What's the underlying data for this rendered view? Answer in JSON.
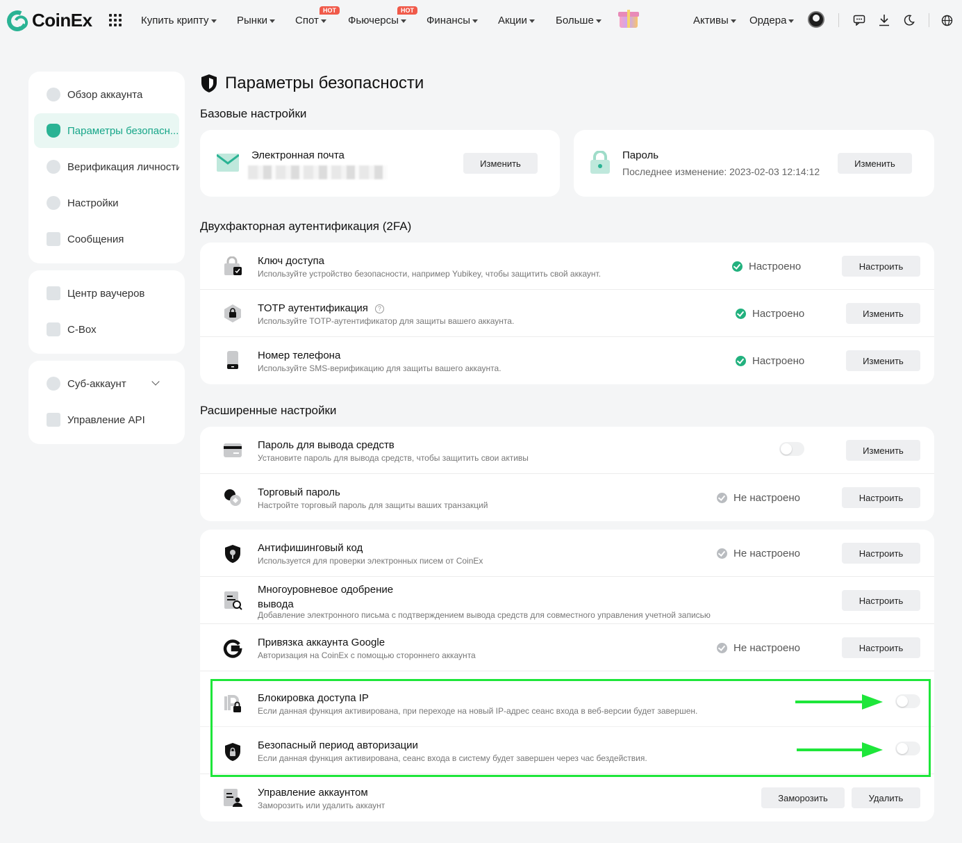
{
  "brand": {
    "name": "CoinEx",
    "accent": "#2ab394"
  },
  "nav": {
    "items": [
      {
        "label": "Купить крипту",
        "dropdown": true
      },
      {
        "label": "Рынки",
        "dropdown": true
      },
      {
        "label": "Спот",
        "dropdown": true,
        "badge": "HOT"
      },
      {
        "label": "Фьючерсы",
        "dropdown": true,
        "badge": "HOT"
      },
      {
        "label": "Финансы",
        "dropdown": true
      },
      {
        "label": "Акции",
        "dropdown": true
      },
      {
        "label": "Больше",
        "dropdown": true
      }
    ],
    "right": [
      {
        "label": "Активы",
        "dropdown": true
      },
      {
        "label": "Ордера",
        "dropdown": true
      }
    ],
    "icons": [
      "avatar",
      "chat-icon",
      "download-icon",
      "moon-icon",
      "globe-icon"
    ]
  },
  "sidebar": {
    "group1": [
      {
        "label": "Обзор аккаунта",
        "active": false
      },
      {
        "label": "Параметры безопасн...",
        "active": true
      },
      {
        "label": "Верификация личности",
        "active": false
      },
      {
        "label": "Настройки",
        "active": false
      },
      {
        "label": "Сообщения",
        "active": false
      }
    ],
    "group2": [
      {
        "label": "Центр ваучеров"
      },
      {
        "label": "C-Box"
      }
    ],
    "group3": [
      {
        "label": "Суб-аккаунт"
      },
      {
        "label": "Управление API"
      }
    ]
  },
  "page": {
    "title": "Параметры безопасности",
    "basic_title": "Базовые настройки",
    "twofa_title": "Двухфакторная аутентификация (2FA)",
    "advanced_title": "Расширенные настройки"
  },
  "basic": {
    "email": {
      "title": "Электронная почта",
      "button": "Изменить"
    },
    "password": {
      "title": "Пароль",
      "last_changed": "Последнее изменение: 2023-02-03 12:14:12",
      "button": "Изменить"
    }
  },
  "twofa": [
    {
      "title": "Ключ доступа",
      "desc": "Используйте устройство безопасности, например Yubikey, чтобы защитить свой аккаунт.",
      "status": "Настроено",
      "button": "Настроить"
    },
    {
      "title": "TOTP аутентификация",
      "desc": "Используйте TOTP-аутентификатор для защиты вашего аккаунта.",
      "status": "Настроено",
      "button": "Изменить"
    },
    {
      "title": "Номер телефона",
      "desc": "Используйте SMS-верификацию для защиты вашего аккаунта.",
      "status": "Настроено",
      "button": "Изменить"
    }
  ],
  "advanced1": [
    {
      "title": "Пароль для вывода средств",
      "desc": "Установите пароль для вывода средств, чтобы защитить свои активы",
      "toggle": false,
      "button": "Изменить"
    },
    {
      "title": "Торговый пароль",
      "desc": "Настройте торговый пароль для защиты ваших транзакций",
      "status": "Не настроено",
      "button": "Настроить"
    }
  ],
  "advanced2": [
    {
      "title": "Антифишинговый код",
      "desc": "Используется для проверки электронных писем от CoinEx",
      "status": "Не настроено",
      "button": "Настроить"
    },
    {
      "title_line1": "Многоуровневое одобрение",
      "title_line2": "вывода",
      "desc": "Добавление электронного письма с подтверждением вывода средств для совместного управления учетной записью",
      "button": "Настроить"
    },
    {
      "title": "Привязка аккаунта Google",
      "desc": "Авторизация на CoinEx с помощью стороннего аккаунта",
      "status": "Не настроено",
      "button": "Настроить"
    },
    {
      "title": "Блокировка доступа IP",
      "desc": "Если данная функция активирована, при переходе на новый IP-адрес сеанс входа в веб-версии будет завершен.",
      "toggle": false
    },
    {
      "title": "Безопасный период авторизации",
      "desc": "Если данная функция активирована, сеанс входа в систему будет завершен через час бездействия.",
      "toggle": false
    },
    {
      "title": "Управление аккаунтом",
      "desc": "Заморозить или удалить аккаунт",
      "button_freeze": "Заморозить",
      "button_delete": "Удалить"
    }
  ],
  "colors": {
    "highlight": "#1ee63a",
    "status_ok": "#22b17e",
    "status_off": "#b9bcc0"
  }
}
